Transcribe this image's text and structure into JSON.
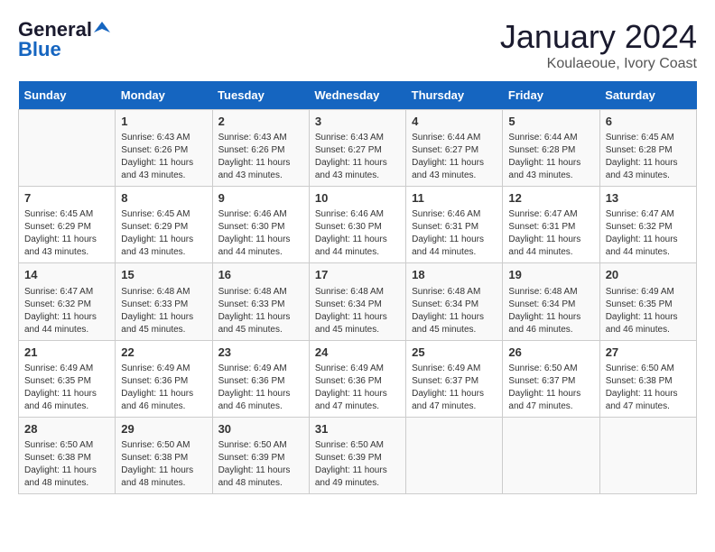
{
  "header": {
    "logo_general": "General",
    "logo_blue": "Blue",
    "month_title": "January 2024",
    "location": "Koulaeoue, Ivory Coast"
  },
  "days_of_week": [
    "Sunday",
    "Monday",
    "Tuesday",
    "Wednesday",
    "Thursday",
    "Friday",
    "Saturday"
  ],
  "weeks": [
    [
      {
        "day": "",
        "info": ""
      },
      {
        "day": "1",
        "info": "Sunrise: 6:43 AM\nSunset: 6:26 PM\nDaylight: 11 hours\nand 43 minutes."
      },
      {
        "day": "2",
        "info": "Sunrise: 6:43 AM\nSunset: 6:26 PM\nDaylight: 11 hours\nand 43 minutes."
      },
      {
        "day": "3",
        "info": "Sunrise: 6:43 AM\nSunset: 6:27 PM\nDaylight: 11 hours\nand 43 minutes."
      },
      {
        "day": "4",
        "info": "Sunrise: 6:44 AM\nSunset: 6:27 PM\nDaylight: 11 hours\nand 43 minutes."
      },
      {
        "day": "5",
        "info": "Sunrise: 6:44 AM\nSunset: 6:28 PM\nDaylight: 11 hours\nand 43 minutes."
      },
      {
        "day": "6",
        "info": "Sunrise: 6:45 AM\nSunset: 6:28 PM\nDaylight: 11 hours\nand 43 minutes."
      }
    ],
    [
      {
        "day": "7",
        "info": "Sunrise: 6:45 AM\nSunset: 6:29 PM\nDaylight: 11 hours\nand 43 minutes."
      },
      {
        "day": "8",
        "info": "Sunrise: 6:45 AM\nSunset: 6:29 PM\nDaylight: 11 hours\nand 43 minutes."
      },
      {
        "day": "9",
        "info": "Sunrise: 6:46 AM\nSunset: 6:30 PM\nDaylight: 11 hours\nand 44 minutes."
      },
      {
        "day": "10",
        "info": "Sunrise: 6:46 AM\nSunset: 6:30 PM\nDaylight: 11 hours\nand 44 minutes."
      },
      {
        "day": "11",
        "info": "Sunrise: 6:46 AM\nSunset: 6:31 PM\nDaylight: 11 hours\nand 44 minutes."
      },
      {
        "day": "12",
        "info": "Sunrise: 6:47 AM\nSunset: 6:31 PM\nDaylight: 11 hours\nand 44 minutes."
      },
      {
        "day": "13",
        "info": "Sunrise: 6:47 AM\nSunset: 6:32 PM\nDaylight: 11 hours\nand 44 minutes."
      }
    ],
    [
      {
        "day": "14",
        "info": "Sunrise: 6:47 AM\nSunset: 6:32 PM\nDaylight: 11 hours\nand 44 minutes."
      },
      {
        "day": "15",
        "info": "Sunrise: 6:48 AM\nSunset: 6:33 PM\nDaylight: 11 hours\nand 45 minutes."
      },
      {
        "day": "16",
        "info": "Sunrise: 6:48 AM\nSunset: 6:33 PM\nDaylight: 11 hours\nand 45 minutes."
      },
      {
        "day": "17",
        "info": "Sunrise: 6:48 AM\nSunset: 6:34 PM\nDaylight: 11 hours\nand 45 minutes."
      },
      {
        "day": "18",
        "info": "Sunrise: 6:48 AM\nSunset: 6:34 PM\nDaylight: 11 hours\nand 45 minutes."
      },
      {
        "day": "19",
        "info": "Sunrise: 6:48 AM\nSunset: 6:34 PM\nDaylight: 11 hours\nand 46 minutes."
      },
      {
        "day": "20",
        "info": "Sunrise: 6:49 AM\nSunset: 6:35 PM\nDaylight: 11 hours\nand 46 minutes."
      }
    ],
    [
      {
        "day": "21",
        "info": "Sunrise: 6:49 AM\nSunset: 6:35 PM\nDaylight: 11 hours\nand 46 minutes."
      },
      {
        "day": "22",
        "info": "Sunrise: 6:49 AM\nSunset: 6:36 PM\nDaylight: 11 hours\nand 46 minutes."
      },
      {
        "day": "23",
        "info": "Sunrise: 6:49 AM\nSunset: 6:36 PM\nDaylight: 11 hours\nand 46 minutes."
      },
      {
        "day": "24",
        "info": "Sunrise: 6:49 AM\nSunset: 6:36 PM\nDaylight: 11 hours\nand 47 minutes."
      },
      {
        "day": "25",
        "info": "Sunrise: 6:49 AM\nSunset: 6:37 PM\nDaylight: 11 hours\nand 47 minutes."
      },
      {
        "day": "26",
        "info": "Sunrise: 6:50 AM\nSunset: 6:37 PM\nDaylight: 11 hours\nand 47 minutes."
      },
      {
        "day": "27",
        "info": "Sunrise: 6:50 AM\nSunset: 6:38 PM\nDaylight: 11 hours\nand 47 minutes."
      }
    ],
    [
      {
        "day": "28",
        "info": "Sunrise: 6:50 AM\nSunset: 6:38 PM\nDaylight: 11 hours\nand 48 minutes."
      },
      {
        "day": "29",
        "info": "Sunrise: 6:50 AM\nSunset: 6:38 PM\nDaylight: 11 hours\nand 48 minutes."
      },
      {
        "day": "30",
        "info": "Sunrise: 6:50 AM\nSunset: 6:39 PM\nDaylight: 11 hours\nand 48 minutes."
      },
      {
        "day": "31",
        "info": "Sunrise: 6:50 AM\nSunset: 6:39 PM\nDaylight: 11 hours\nand 49 minutes."
      },
      {
        "day": "",
        "info": ""
      },
      {
        "day": "",
        "info": ""
      },
      {
        "day": "",
        "info": ""
      }
    ]
  ]
}
